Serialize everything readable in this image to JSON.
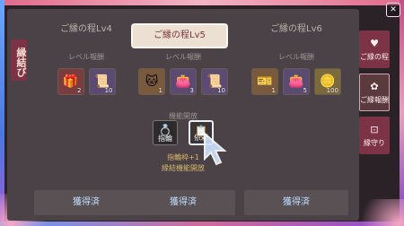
{
  "badge": "縁結び",
  "columns": [
    {
      "title": "ご縁の程Lv4",
      "sub_label": "レベル報酬",
      "items": [
        {
          "icon": "gift-icon",
          "glyph": "🎁",
          "qty": "2",
          "rarity": "red"
        },
        {
          "icon": "scroll-icon",
          "glyph": "📜",
          "qty": "10",
          "rarity": "purple"
        }
      ],
      "claim_label": "獲得済"
    },
    {
      "title": "ご縁の程Lv5",
      "sub_label": "レベル報酬",
      "items": [
        {
          "icon": "mascot-icon",
          "glyph": "🐱",
          "qty": "1",
          "rarity": "orange"
        },
        {
          "icon": "pouch-icon",
          "glyph": "👛",
          "qty": "3",
          "rarity": "purple"
        },
        {
          "icon": "scroll-icon",
          "glyph": "📜",
          "qty": "10",
          "rarity": "purple"
        }
      ],
      "unlock_title": "機能開放",
      "unlocks": [
        {
          "label": "指輪",
          "glyph": "💍",
          "selected": false
        },
        {
          "label": "依頼",
          "glyph": "📋",
          "selected": true
        }
      ],
      "note_1": "指輪枠+1",
      "note_2": "縁結機能開放",
      "claim_label": "獲得済"
    },
    {
      "title": "ご縁の程Lv6",
      "sub_label": "レベル報酬",
      "items": [
        {
          "icon": "ticket-icon",
          "glyph": "🎫",
          "qty": "1",
          "rarity": "orange"
        },
        {
          "icon": "pouch-icon",
          "glyph": "👛",
          "qty": "5",
          "rarity": "purple"
        },
        {
          "icon": "coin-icon",
          "glyph": "🪙",
          "qty": "100",
          "rarity": "gold"
        }
      ],
      "claim_label": "獲得済"
    }
  ],
  "menu": [
    {
      "label": "ご縁の程",
      "icon": "heart-icon",
      "glyph": "♥"
    },
    {
      "label": "ご縁報酬",
      "icon": "gift-icon",
      "glyph": "✿"
    },
    {
      "label": "縁守り",
      "icon": "charm-icon",
      "glyph": "⊡"
    }
  ]
}
